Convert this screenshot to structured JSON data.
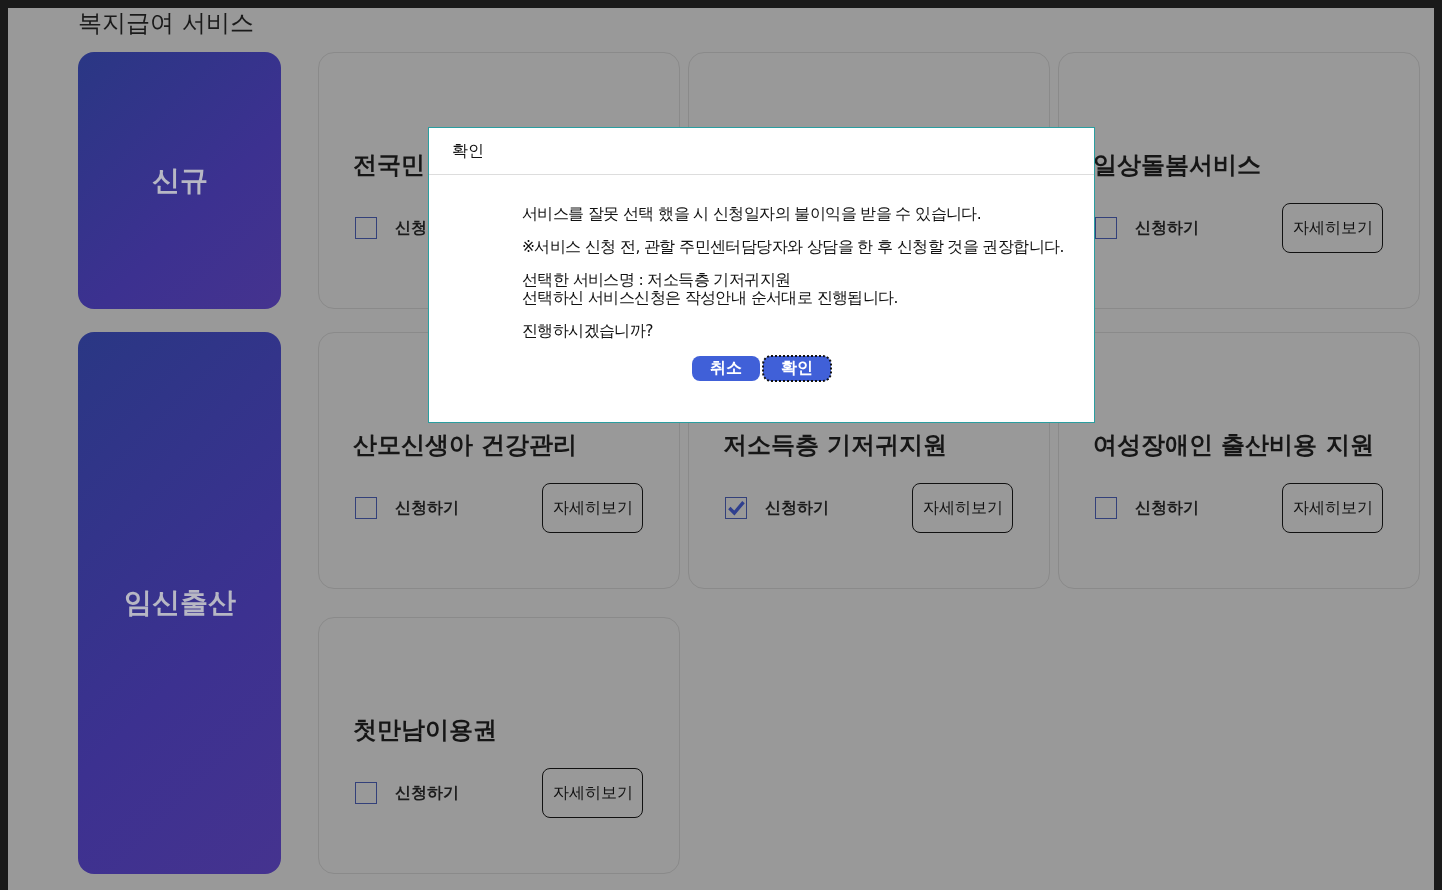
{
  "page_title": "복지급여 서비스",
  "categories": [
    {
      "label": "신규",
      "cards": [
        {
          "kind": "service",
          "title": "전국민",
          "apply_label": "신청",
          "apply_checked": false
        },
        {
          "kind": "blank"
        },
        {
          "kind": "service",
          "title": "일상돌봄서비스",
          "apply_label": "신청하기",
          "apply_checked": false,
          "details_button": "자세히보기"
        }
      ]
    },
    {
      "label": "임신출산",
      "cards": [
        {
          "kind": "service",
          "title": "산모신생아 건강관리",
          "apply_label": "신청하기",
          "apply_checked": false,
          "details_button": "자세히보기"
        },
        {
          "kind": "service",
          "title": "저소득층 기저귀지원",
          "apply_label": "신청하기",
          "apply_checked": true,
          "details_button": "자세히보기"
        },
        {
          "kind": "service",
          "title": "여성장애인 출산비용 지원",
          "apply_label": "신청하기",
          "apply_checked": false,
          "details_button": "자세히보기"
        },
        {
          "kind": "service",
          "title": "첫만남이용권",
          "apply_label": "신청하기",
          "apply_checked": false,
          "details_button": "자세히보기"
        }
      ]
    }
  ],
  "dialog": {
    "title": "확인",
    "paragraphs": [
      [
        "서비스를 잘못 선택 했을 시 신청일자의 불이익을 받을 수 있습니다."
      ],
      [
        "※서비스 신청 전, 관할 주민센터담당자와 상담을 한 후 신청할 것을 권장합니다."
      ],
      [
        "선택한 서비스명 : 저소득층 기저귀지원",
        "선택하신 서비스신청은 작성안내 순서대로 진행됩니다."
      ],
      [
        "진행하시겠습니까?"
      ]
    ],
    "buttons": [
      {
        "label": "취소",
        "focused": false
      },
      {
        "label": "확인",
        "focused": true
      }
    ]
  }
}
